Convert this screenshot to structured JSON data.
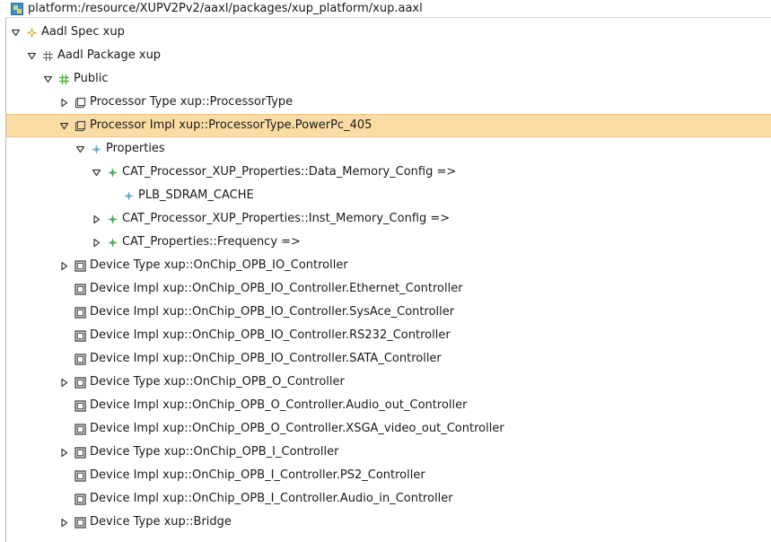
{
  "window": {
    "title": "platform:/resource/XUPV2Pv2/aaxl/packages/xup_platform/xup.aaxl"
  },
  "colors": {
    "selection_bg": "#fbdca4",
    "selection_border": "#f2c27b",
    "spec_icon": "#c6b14a",
    "public_icon": "#4fae3a",
    "property_icon": "#69a8cf",
    "property_assoc_icon": "#53a85a"
  },
  "tree": {
    "items": [
      {
        "label": "Aadl Spec xup",
        "twisty": "expanded",
        "icon": "aadl-spec-icon"
      },
      {
        "label": "Aadl Package xup",
        "twisty": "expanded",
        "icon": "aadl-package-icon"
      },
      {
        "label": "Public",
        "twisty": "expanded",
        "icon": "public-section-icon"
      },
      {
        "label": "Processor Type xup::ProcessorType",
        "twisty": "collapsed",
        "icon": "processor-icon"
      },
      {
        "label": "Processor Impl xup::ProcessorType.PowerPc_405",
        "twisty": "expanded",
        "icon": "processor-icon",
        "selected": true
      },
      {
        "label": "Properties",
        "twisty": "expanded",
        "icon": "properties-icon"
      },
      {
        "label": "CAT_Processor_XUP_Properties::Data_Memory_Config =>",
        "twisty": "expanded",
        "icon": "property-association-icon"
      },
      {
        "label": "PLB_SDRAM_CACHE",
        "twisty": "none",
        "icon": "property-value-icon"
      },
      {
        "label": "CAT_Processor_XUP_Properties::Inst_Memory_Config =>",
        "twisty": "collapsed",
        "icon": "property-association-icon"
      },
      {
        "label": "CAT_Properties::Frequency =>",
        "twisty": "collapsed",
        "icon": "property-association-icon"
      },
      {
        "label": "Device Type xup::OnChip_OPB_IO_Controller",
        "twisty": "collapsed",
        "icon": "device-icon"
      },
      {
        "label": "Device Impl xup::OnChip_OPB_IO_Controller.Ethernet_Controller",
        "twisty": "none",
        "icon": "device-icon"
      },
      {
        "label": "Device Impl xup::OnChip_OPB_IO_Controller.SysAce_Controller",
        "twisty": "none",
        "icon": "device-icon"
      },
      {
        "label": "Device Impl xup::OnChip_OPB_IO_Controller.RS232_Controller",
        "twisty": "none",
        "icon": "device-icon"
      },
      {
        "label": "Device Impl xup::OnChip_OPB_IO_Controller.SATA_Controller",
        "twisty": "none",
        "icon": "device-icon"
      },
      {
        "label": "Device Type xup::OnChip_OPB_O_Controller",
        "twisty": "collapsed",
        "icon": "device-icon"
      },
      {
        "label": "Device Impl xup::OnChip_OPB_O_Controller.Audio_out_Controller",
        "twisty": "none",
        "icon": "device-icon"
      },
      {
        "label": "Device Impl xup::OnChip_OPB_O_Controller.XSGA_video_out_Controller",
        "twisty": "none",
        "icon": "device-icon"
      },
      {
        "label": "Device Type xup::OnChip_OPB_I_Controller",
        "twisty": "collapsed",
        "icon": "device-icon"
      },
      {
        "label": "Device Impl xup::OnChip_OPB_I_Controller.PS2_Controller",
        "twisty": "none",
        "icon": "device-icon"
      },
      {
        "label": "Device Impl xup::OnChip_OPB_I_Controller.Audio_in_Controller",
        "twisty": "none",
        "icon": "device-icon"
      },
      {
        "label": "Device Type xup::Bridge",
        "twisty": "collapsed",
        "icon": "device-icon"
      }
    ]
  }
}
